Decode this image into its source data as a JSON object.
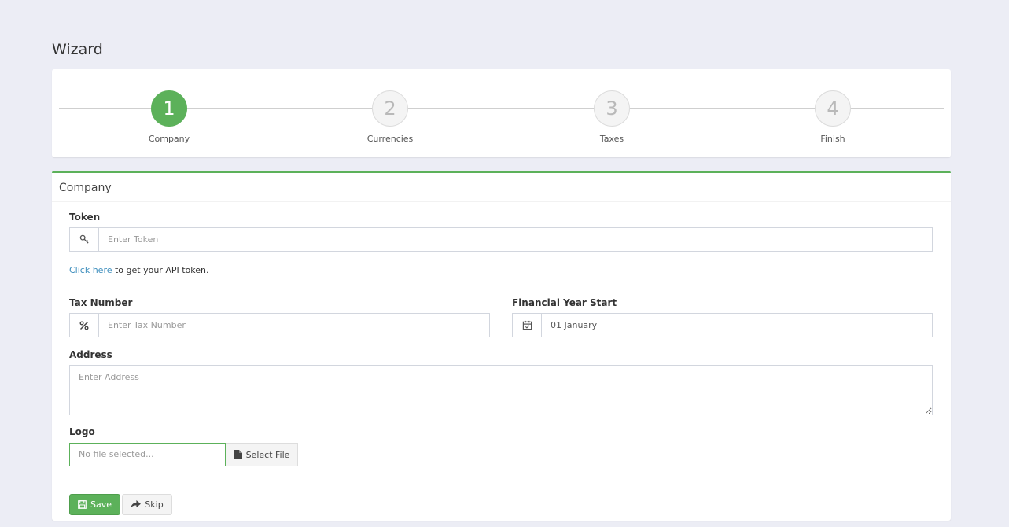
{
  "page": {
    "title": "Wizard"
  },
  "steps": [
    {
      "number": "1",
      "label": "Company",
      "active": true
    },
    {
      "number": "2",
      "label": "Currencies",
      "active": false
    },
    {
      "number": "3",
      "label": "Taxes",
      "active": false
    },
    {
      "number": "4",
      "label": "Finish",
      "active": false
    }
  ],
  "form": {
    "title": "Company",
    "token": {
      "label": "Token",
      "placeholder": "Enter Token",
      "icon": "key-icon"
    },
    "helper": {
      "link_text": "Click here",
      "rest": " to get your API token."
    },
    "tax_number": {
      "label": "Tax Number",
      "placeholder": "Enter Tax Number",
      "icon": "percent-icon"
    },
    "financial_year": {
      "label": "Financial Year Start",
      "value": "01 January",
      "icon": "calendar-icon"
    },
    "address": {
      "label": "Address",
      "placeholder": "Enter Address"
    },
    "logo": {
      "label": "Logo",
      "file_text": "No file selected...",
      "button_label": "Select File",
      "icon": "file-icon"
    }
  },
  "footer": {
    "save_label": "Save",
    "skip_label": "Skip"
  },
  "colors": {
    "accent": "#5cb15a",
    "link": "#3c8dbc",
    "background": "#ecedf5"
  }
}
